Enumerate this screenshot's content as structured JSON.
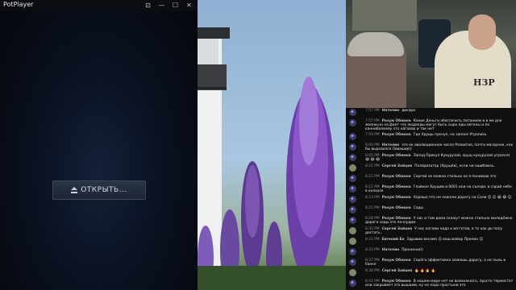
{
  "potplayer": {
    "title": "PotPlayer",
    "controls": {
      "pin": "⊡",
      "minimize": "—",
      "maximize": "☐",
      "close": "✕"
    },
    "open_button": "ОТКРЫТЬ..."
  },
  "webcam": {
    "shirt_text": "НЗР"
  },
  "chat": {
    "messages": [
      {
        "time": "7:57 PM",
        "author": "Нателин",
        "text": "дикари",
        "avatar": "diamond"
      },
      {
        "time": "7:57 PM",
        "author": "Разум Обмана",
        "text": "Какие Деньги обеспечить питанием в в ем для жизни,но на факт что людоеды могут быть сыро еды вегены и по каннибализму это наговор и так нет",
        "avatar": "diamond"
      },
      {
        "time": "7:59 PM",
        "author": "Разум Обмана",
        "text": "Где Хрущь пукнул, на запасе Угрались",
        "avatar": "diamond"
      },
      {
        "time": "8:00 PM",
        "author": "Нателин",
        "text": "это ек иволюционное число Развития, почти маскрное, как бы выразился Левашов))",
        "avatar": "diamond"
      },
      {
        "time": "8:05 PM",
        "author": "Разум Обмана",
        "text": "Запад Прикул Кукурузой, хрущ кукурузой угрался) 😂 😂 😂",
        "avatar": "diamond"
      },
      {
        "time": "8:21 PM",
        "author": "Сергей Зайцев",
        "text": "Поляризатор (Хрущёв), если ни ошибаюсь.",
        "avatar": "photo"
      },
      {
        "time": "8:22 PM",
        "author": "Разум Обмана",
        "text": "Сергей не можно стильно ко я понимаю это",
        "avatar": "diamond"
      },
      {
        "time": "8:22 PM",
        "author": "Разум Обмана",
        "text": "Главное Хрущев в 0001 или на съезде, в сарай небе в колхозе",
        "avatar": "diamond"
      },
      {
        "time": "8:23 PM",
        "author": "Разум Обмана",
        "text": "Хорошо что не нежели дорогу на Соли 😊 😊 😂 😂 😊",
        "avatar": "diamond"
      },
      {
        "time": "8:25 PM",
        "author": "Разум Обмана",
        "text": "Сады",
        "avatar": "diamond"
      },
      {
        "time": "8:28 PM",
        "author": "Разум Обмана",
        "text": "У нас и там дома скажут можно стильно молодёжно дорога соды это почлудим",
        "avatar": "diamond"
      },
      {
        "time": "8:30 PM",
        "author": "Сергей Зайцев",
        "text": "У нас ногами надо к ия готов, а то как до попу достать..",
        "avatar": "photo"
      },
      {
        "time": "8:31 PM",
        "author": "Евгений Ен",
        "text": "Здравии весомо 😊 ваш майор Пронин 😊",
        "avatar": "photo"
      },
      {
        "time": "8:33 PM",
        "author": "Нателин",
        "text": "Пронинни))",
        "avatar": "diamond"
      },
      {
        "time": "8:37 PM",
        "author": "Разум Обмана",
        "text": "Серёга эффективно можешь дорогу, а не пыль в банке",
        "avatar": "diamond"
      },
      {
        "time": "8:38 PM",
        "author": "Сергей Зайцев",
        "text": "🔥 🔥 🔥 🔥",
        "avatar": "photo"
      },
      {
        "time": "8:41 PM",
        "author": "Разум Обмана",
        "text": "В нашем мире нет не возможного, просто термостат или закрывает это вышами, ну не надо простыни это",
        "avatar": "diamond"
      }
    ]
  }
}
